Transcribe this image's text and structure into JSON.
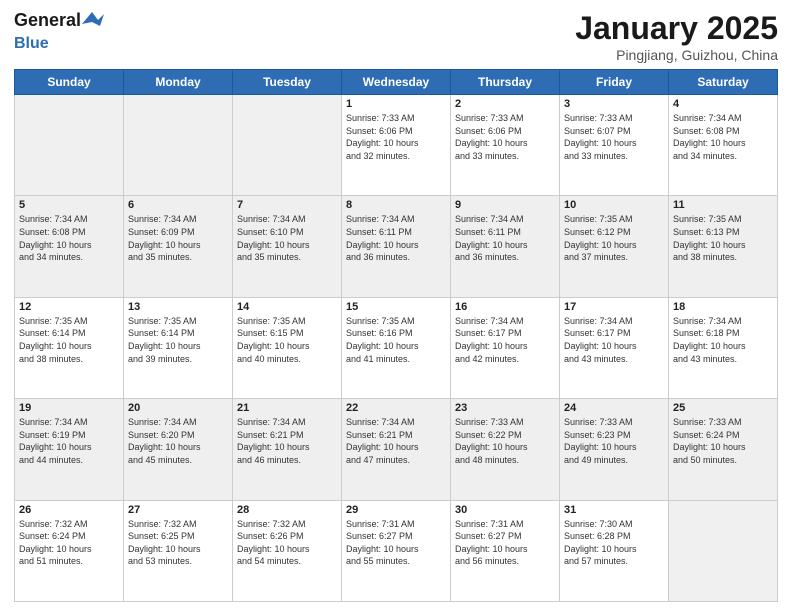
{
  "header": {
    "logo_line1": "General",
    "logo_line2": "Blue",
    "month": "January 2025",
    "location": "Pingjiang, Guizhou, China"
  },
  "days_of_week": [
    "Sunday",
    "Monday",
    "Tuesday",
    "Wednesday",
    "Thursday",
    "Friday",
    "Saturday"
  ],
  "weeks": [
    [
      {
        "day": "",
        "text": ""
      },
      {
        "day": "",
        "text": ""
      },
      {
        "day": "",
        "text": ""
      },
      {
        "day": "1",
        "text": "Sunrise: 7:33 AM\nSunset: 6:06 PM\nDaylight: 10 hours\nand 32 minutes."
      },
      {
        "day": "2",
        "text": "Sunrise: 7:33 AM\nSunset: 6:06 PM\nDaylight: 10 hours\nand 33 minutes."
      },
      {
        "day": "3",
        "text": "Sunrise: 7:33 AM\nSunset: 6:07 PM\nDaylight: 10 hours\nand 33 minutes."
      },
      {
        "day": "4",
        "text": "Sunrise: 7:34 AM\nSunset: 6:08 PM\nDaylight: 10 hours\nand 34 minutes."
      }
    ],
    [
      {
        "day": "5",
        "text": "Sunrise: 7:34 AM\nSunset: 6:08 PM\nDaylight: 10 hours\nand 34 minutes."
      },
      {
        "day": "6",
        "text": "Sunrise: 7:34 AM\nSunset: 6:09 PM\nDaylight: 10 hours\nand 35 minutes."
      },
      {
        "day": "7",
        "text": "Sunrise: 7:34 AM\nSunset: 6:10 PM\nDaylight: 10 hours\nand 35 minutes."
      },
      {
        "day": "8",
        "text": "Sunrise: 7:34 AM\nSunset: 6:11 PM\nDaylight: 10 hours\nand 36 minutes."
      },
      {
        "day": "9",
        "text": "Sunrise: 7:34 AM\nSunset: 6:11 PM\nDaylight: 10 hours\nand 36 minutes."
      },
      {
        "day": "10",
        "text": "Sunrise: 7:35 AM\nSunset: 6:12 PM\nDaylight: 10 hours\nand 37 minutes."
      },
      {
        "day": "11",
        "text": "Sunrise: 7:35 AM\nSunset: 6:13 PM\nDaylight: 10 hours\nand 38 minutes."
      }
    ],
    [
      {
        "day": "12",
        "text": "Sunrise: 7:35 AM\nSunset: 6:14 PM\nDaylight: 10 hours\nand 38 minutes."
      },
      {
        "day": "13",
        "text": "Sunrise: 7:35 AM\nSunset: 6:14 PM\nDaylight: 10 hours\nand 39 minutes."
      },
      {
        "day": "14",
        "text": "Sunrise: 7:35 AM\nSunset: 6:15 PM\nDaylight: 10 hours\nand 40 minutes."
      },
      {
        "day": "15",
        "text": "Sunrise: 7:35 AM\nSunset: 6:16 PM\nDaylight: 10 hours\nand 41 minutes."
      },
      {
        "day": "16",
        "text": "Sunrise: 7:34 AM\nSunset: 6:17 PM\nDaylight: 10 hours\nand 42 minutes."
      },
      {
        "day": "17",
        "text": "Sunrise: 7:34 AM\nSunset: 6:17 PM\nDaylight: 10 hours\nand 43 minutes."
      },
      {
        "day": "18",
        "text": "Sunrise: 7:34 AM\nSunset: 6:18 PM\nDaylight: 10 hours\nand 43 minutes."
      }
    ],
    [
      {
        "day": "19",
        "text": "Sunrise: 7:34 AM\nSunset: 6:19 PM\nDaylight: 10 hours\nand 44 minutes."
      },
      {
        "day": "20",
        "text": "Sunrise: 7:34 AM\nSunset: 6:20 PM\nDaylight: 10 hours\nand 45 minutes."
      },
      {
        "day": "21",
        "text": "Sunrise: 7:34 AM\nSunset: 6:21 PM\nDaylight: 10 hours\nand 46 minutes."
      },
      {
        "day": "22",
        "text": "Sunrise: 7:34 AM\nSunset: 6:21 PM\nDaylight: 10 hours\nand 47 minutes."
      },
      {
        "day": "23",
        "text": "Sunrise: 7:33 AM\nSunset: 6:22 PM\nDaylight: 10 hours\nand 48 minutes."
      },
      {
        "day": "24",
        "text": "Sunrise: 7:33 AM\nSunset: 6:23 PM\nDaylight: 10 hours\nand 49 minutes."
      },
      {
        "day": "25",
        "text": "Sunrise: 7:33 AM\nSunset: 6:24 PM\nDaylight: 10 hours\nand 50 minutes."
      }
    ],
    [
      {
        "day": "26",
        "text": "Sunrise: 7:32 AM\nSunset: 6:24 PM\nDaylight: 10 hours\nand 51 minutes."
      },
      {
        "day": "27",
        "text": "Sunrise: 7:32 AM\nSunset: 6:25 PM\nDaylight: 10 hours\nand 53 minutes."
      },
      {
        "day": "28",
        "text": "Sunrise: 7:32 AM\nSunset: 6:26 PM\nDaylight: 10 hours\nand 54 minutes."
      },
      {
        "day": "29",
        "text": "Sunrise: 7:31 AM\nSunset: 6:27 PM\nDaylight: 10 hours\nand 55 minutes."
      },
      {
        "day": "30",
        "text": "Sunrise: 7:31 AM\nSunset: 6:27 PM\nDaylight: 10 hours\nand 56 minutes."
      },
      {
        "day": "31",
        "text": "Sunrise: 7:30 AM\nSunset: 6:28 PM\nDaylight: 10 hours\nand 57 minutes."
      },
      {
        "day": "",
        "text": ""
      }
    ]
  ]
}
